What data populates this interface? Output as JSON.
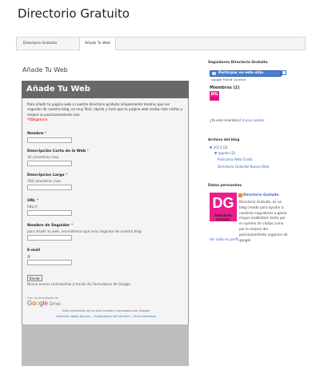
{
  "blog": {
    "title": "Directorio Gratuito"
  },
  "tabs": [
    {
      "label": "Directorio Gratuito"
    },
    {
      "label": "Añade Tu Web"
    }
  ],
  "post": {
    "title": "Añade Tu Web"
  },
  "form": {
    "title": "Añade Tu Web",
    "description": "Para añadir tu pagina web a nuestro directorio gratuito simplemente tendras que ser seguidor de nuestro blog, es muy fácil, rápido y hará que tu pagina web reciba más visitas y mejore su posicionamiento seo.",
    "required_note": "*Obligatorio",
    "fields": [
      {
        "label": "Nombre",
        "required": "*",
        "help": "",
        "value": ""
      },
      {
        "label": "Descripción Corta de la Web",
        "required": "*",
        "help": "30 caracteres max.",
        "value": ""
      },
      {
        "label": "Descripcion Larga",
        "required": "*",
        "help": "150 caracteres max.",
        "value": ""
      },
      {
        "label": "URL",
        "required": "*",
        "help": "",
        "value": "http://"
      },
      {
        "label": "Nombre de Seguidor",
        "required": "*",
        "help": "para añadir tu web, necesitemos que seas seguidor de nuestro blog",
        "value": ""
      },
      {
        "label": "E-mail",
        "required": "",
        "help": "",
        "value": "@"
      }
    ],
    "submit_label": "Enviar",
    "never_passwords": "Nunca envíes contraseñas a través de Formularios de Google.",
    "powered_by": "Con la tecnología de",
    "brand": {
      "google": [
        "G",
        "o",
        "o",
        "g",
        "l",
        "e"
      ],
      "drive": "Drive"
    },
    "created_note": "Este contenido no ha sido creado ni aprobado por Google.",
    "footer_links": "Informar sobre abusos - Condiciones del servicio - Otros términos"
  },
  "sidebar": {
    "followers": {
      "heading": "Seguidores Directorio Gratuito",
      "join_label": "Participar en este sitio",
      "gfc_label": "Google Friend Connect",
      "members_label": "Miembros (2)",
      "member_logo": "DG",
      "member_logo_sub": "Directorio Gratuito",
      "already_member": "¿Ya eres miembro?",
      "sign_in": "Iniciar sesión"
    },
    "archive": {
      "heading": "Archivo del blog",
      "year": "2013",
      "year_count": "(2)",
      "month": "agosto",
      "month_count": "(2)",
      "posts": [
        "Posiciona Web Gratis",
        "Directorio Gratuito Nueva Web"
      ]
    },
    "about": {
      "heading": "Datos personales",
      "logo": "DG",
      "logo_sub": "Directorio Gratuito",
      "name_link": "Directorio Gratuito",
      "bio": "Directorio Gratuito, es un blog creado para ayudar a nuestros seguidores a ganar mayor visibilidad, tanto por el numero de visitas como por la mejora del posicionamiento organico de google",
      "profile_link": "Ver todo mi perfil"
    }
  },
  "colors": {
    "form_header": "#686868",
    "form_frame": "#bdbdbd",
    "required": "#cc0000",
    "link": "#3366cc",
    "logo_bg": "#e91e8c"
  }
}
